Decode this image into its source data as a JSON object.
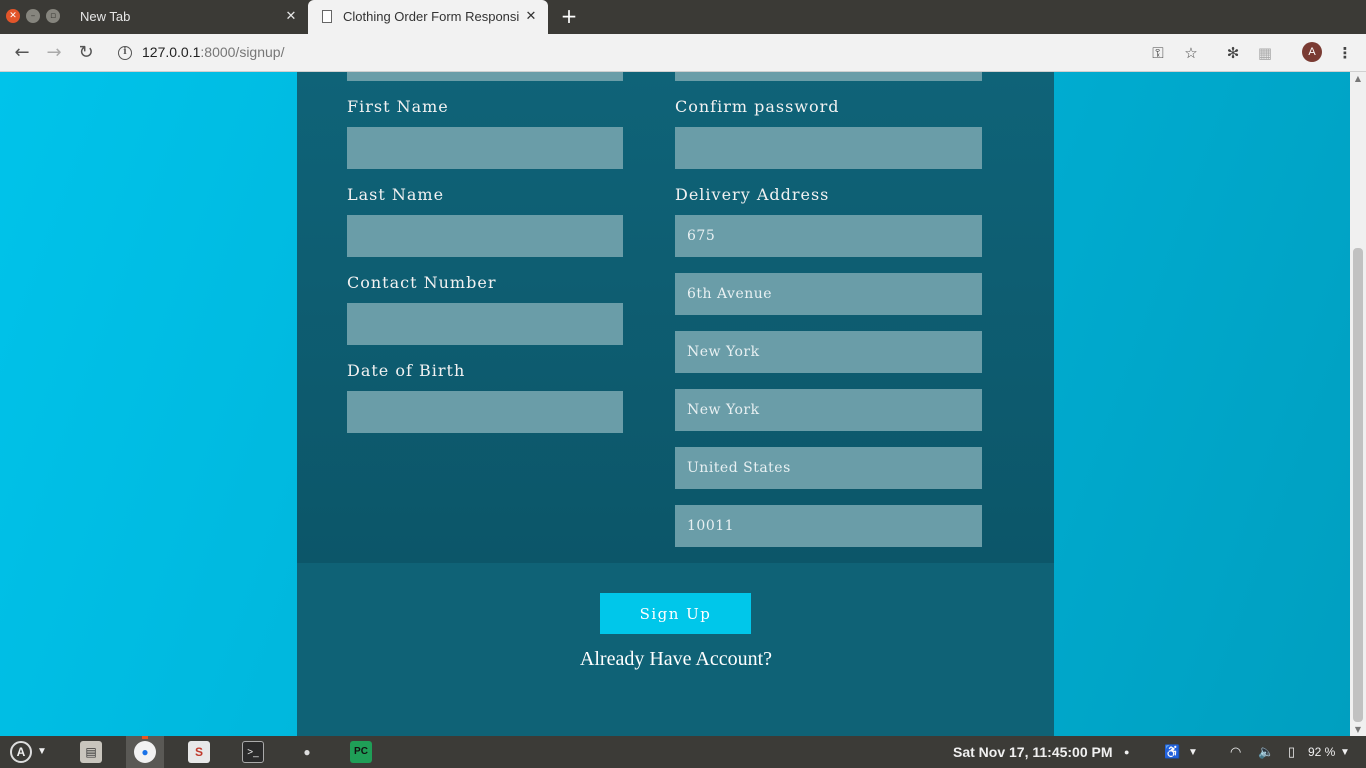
{
  "browser": {
    "tabs": [
      {
        "title": "New Tab",
        "active": false
      },
      {
        "title": "Clothing Order Form Responsive",
        "active": true
      }
    ],
    "url_host": "127.0.0.1",
    "url_rest": ":8000/signup/"
  },
  "form": {
    "left_fields": [
      {
        "label": "First Name",
        "value": ""
      },
      {
        "label": "Last Name",
        "value": ""
      },
      {
        "label": "Contact Number",
        "value": ""
      },
      {
        "label": "Date of Birth",
        "value": ""
      }
    ],
    "confirm_password": {
      "label": "Confirm password",
      "value": ""
    },
    "delivery": {
      "label": "Delivery Address",
      "placeholders": [
        "675",
        "6th Avenue",
        "New York",
        "New York",
        "United States",
        "10011"
      ]
    },
    "signup_label": "Sign Up",
    "already_account": "Already Have Account?"
  },
  "taskbar": {
    "clock": "Sat Nov 17, 11:45:00 PM",
    "battery": "92 %"
  },
  "colors": {
    "page_bg": "#00b5d6",
    "panel": "#0f6276",
    "field": "#6a9da8",
    "button": "#00c7ea"
  }
}
